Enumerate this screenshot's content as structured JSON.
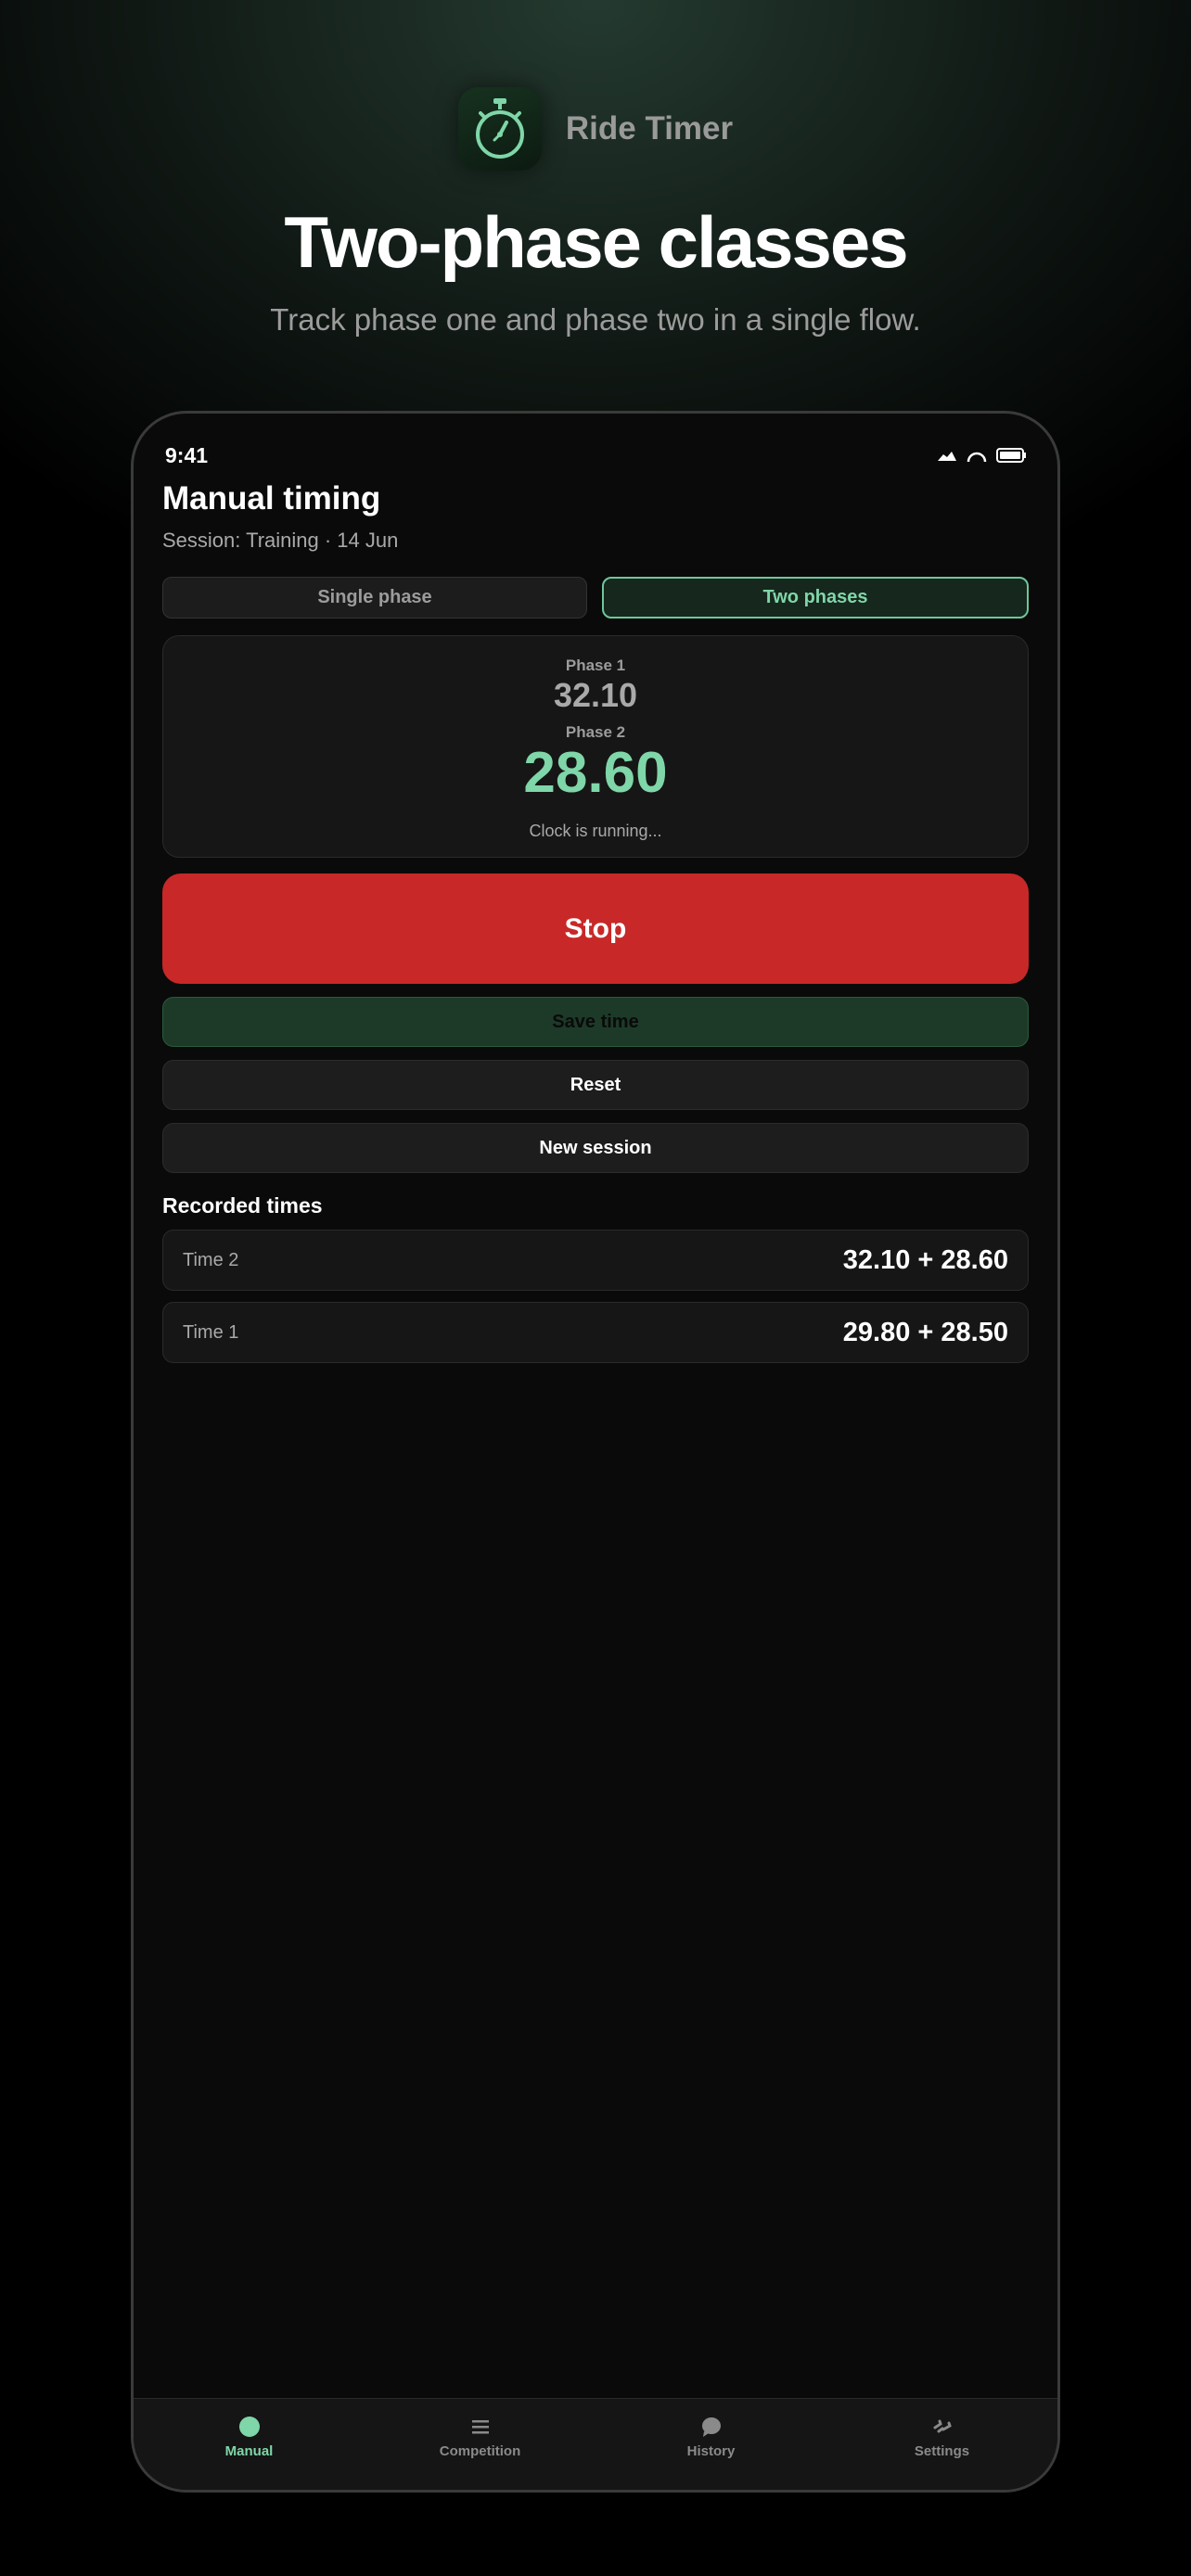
{
  "brand": {
    "app_name": "Ride Timer",
    "accent": "#7fd6a8"
  },
  "hero": {
    "headline": "Two-phase classes",
    "subhead": "Track phase one and phase two in a single flow."
  },
  "status_bar": {
    "time": "9:41"
  },
  "screen": {
    "title": "Manual timing",
    "session": "Session: Training · 14 Jun",
    "modes": [
      {
        "label": "Single phase",
        "selected": false
      },
      {
        "label": "Two phases",
        "selected": true
      }
    ],
    "timer": {
      "phase1_label": "Phase 1",
      "phase1_value": "32.10",
      "phase2_label": "Phase 2",
      "phase2_value": "28.60",
      "status": "Clock is running..."
    },
    "actions": {
      "stop": "Stop",
      "save": "Save time",
      "reset": "Reset",
      "new_session": "New session"
    },
    "recorded": {
      "title": "Recorded times",
      "rows": [
        {
          "label": "Time 2",
          "value": "32.10 + 28.60"
        },
        {
          "label": "Time 1",
          "value": "29.80 + 28.50"
        }
      ]
    }
  },
  "tabs": [
    {
      "label": "Manual",
      "icon": "dot-icon",
      "active": true
    },
    {
      "label": "Competition",
      "icon": "list-icon",
      "active": false
    },
    {
      "label": "History",
      "icon": "chat-bubble-icon",
      "active": false
    },
    {
      "label": "Settings",
      "icon": "gear-icon",
      "active": false
    }
  ],
  "colors": {
    "stop": "#c82828",
    "save": "#1d3a29",
    "background": "#0a0a0a"
  }
}
